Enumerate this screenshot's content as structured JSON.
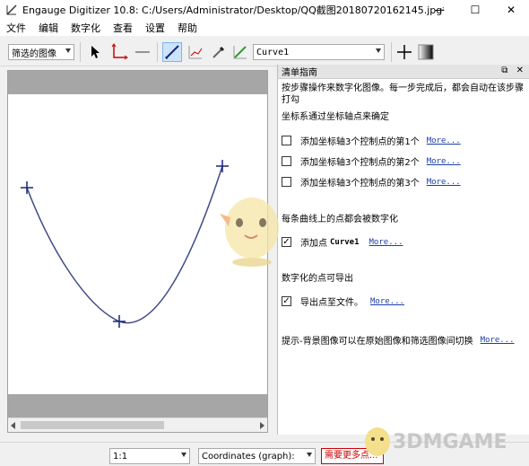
{
  "window": {
    "title": "Engauge Digitizer 10.8: C:/Users/Administrator/Desktop/QQ截图20180720162145.jpg*",
    "minimize_glyph": "—",
    "maximize_glyph": "☐",
    "close_glyph": "✕"
  },
  "menu": {
    "items": [
      "文件",
      "编辑",
      "数字化",
      "查看",
      "设置",
      "帮助"
    ]
  },
  "toolbar": {
    "background_selector": "筛选的图像",
    "curve_selector": "Curve1"
  },
  "checklist": {
    "panel_title": "清单指南",
    "panel_controls": "⧉ ✕",
    "intro": "按步骤操作来数字化图像。每一步完成后，都会自动在该步骤打勾",
    "section_axes": "坐标系通过坐标轴点来确定",
    "steps_axes": [
      {
        "label": "添加坐标轴3个控制点的第1个",
        "more": "More...",
        "checked": false
      },
      {
        "label": "添加坐标轴3个控制点的第2个",
        "more": "More...",
        "checked": false
      },
      {
        "label": "添加坐标轴3个控制点的第3个",
        "more": "More...",
        "checked": false
      }
    ],
    "section_curve": "每条曲线上的点都会被数字化",
    "step_curve": {
      "prefix": "添加点",
      "curve": "Curve1",
      "more": "More...",
      "checked": true
    },
    "section_export": "数字化的点可导出",
    "step_export": {
      "label": "导出点至文件。",
      "more": "More...",
      "checked": true
    },
    "tip": "提示-背景图像可以在原始图像和筛选图像间切换",
    "tip_more": "More..."
  },
  "status": {
    "zoom": "1:1",
    "coordinates": "Coordinates (graph):",
    "notice": "需要更多点..."
  },
  "watermark": {
    "text": "3DMGAME"
  },
  "colors": {
    "curve": "#3f4a8a",
    "cross": "#1a237e",
    "link": "#1a3fa8",
    "status_red": "#cc0000"
  }
}
